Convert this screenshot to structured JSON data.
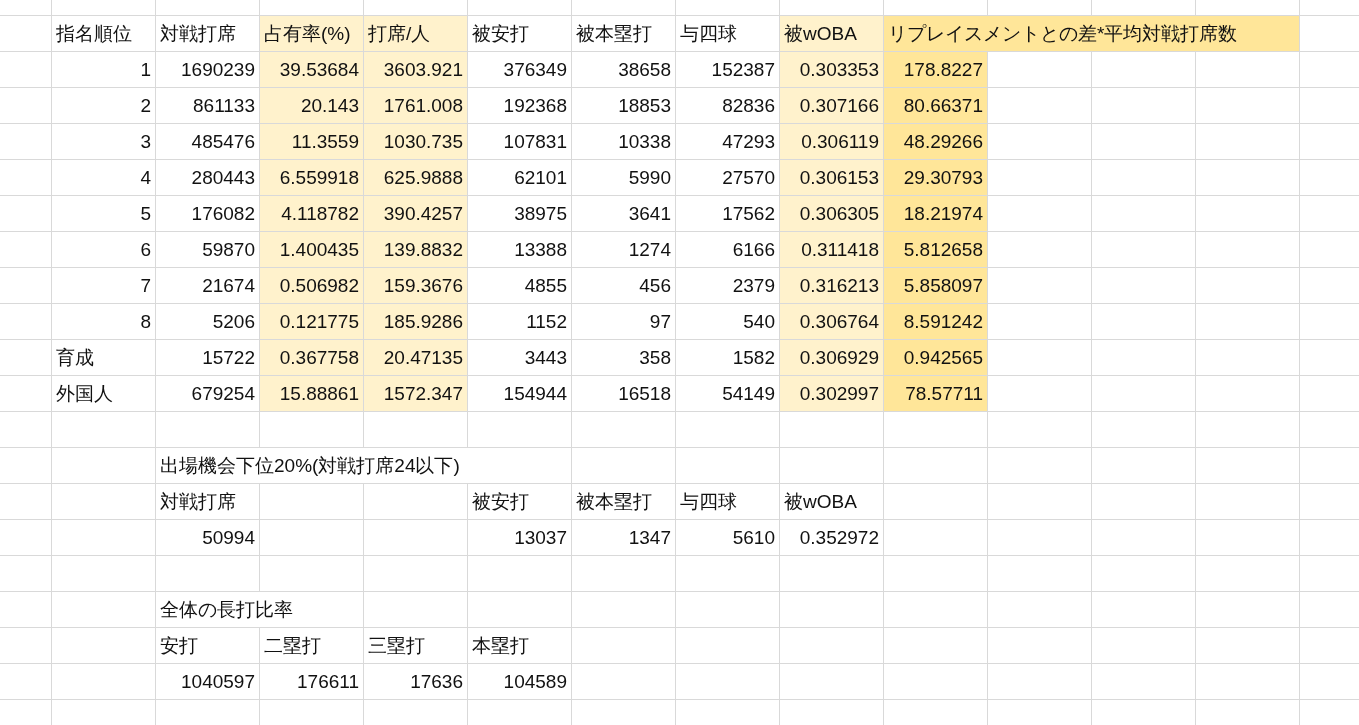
{
  "rows": [
    {
      "cells": [
        {
          "text": "指名順位",
          "kind": "text"
        },
        {
          "text": "対戦打席",
          "kind": "text"
        },
        {
          "text": "占有率(%)",
          "kind": "text",
          "color": "#fff2cc"
        },
        {
          "text": "打席/人",
          "kind": "text",
          "color": "#fff2cc"
        },
        {
          "text": "被安打",
          "kind": "text"
        },
        {
          "text": "被本塁打",
          "kind": "text"
        },
        {
          "text": "与四球",
          "kind": "text"
        },
        {
          "text": "被wOBA",
          "kind": "text",
          "color": "#fff2cc"
        },
        {
          "text": "リプレイスメントとの差*平均対戦打席数",
          "kind": "text",
          "color": "#ffe699"
        }
      ]
    },
    {
      "cells": [
        {
          "text": "1",
          "kind": "number"
        },
        {
          "text": "1690239",
          "kind": "number"
        },
        {
          "text": "39.53684",
          "kind": "number",
          "color": "#fff2cc"
        },
        {
          "text": "3603.921",
          "kind": "number",
          "color": "#fff2cc"
        },
        {
          "text": "376349",
          "kind": "number"
        },
        {
          "text": "38658",
          "kind": "number"
        },
        {
          "text": "152387",
          "kind": "number"
        },
        {
          "text": "0.303353",
          "kind": "number",
          "color": "#fff2cc"
        },
        {
          "text": "178.8227",
          "kind": "number",
          "color": "#ffe699"
        }
      ]
    },
    {
      "cells": [
        {
          "text": "2",
          "kind": "number"
        },
        {
          "text": "861133",
          "kind": "number"
        },
        {
          "text": "20.143",
          "kind": "number",
          "color": "#fff2cc"
        },
        {
          "text": "1761.008",
          "kind": "number",
          "color": "#fff2cc"
        },
        {
          "text": "192368",
          "kind": "number"
        },
        {
          "text": "18853",
          "kind": "number"
        },
        {
          "text": "82836",
          "kind": "number"
        },
        {
          "text": "0.307166",
          "kind": "number",
          "color": "#fff2cc"
        },
        {
          "text": "80.66371",
          "kind": "number",
          "color": "#ffe699"
        }
      ]
    },
    {
      "cells": [
        {
          "text": "3",
          "kind": "number"
        },
        {
          "text": "485476",
          "kind": "number"
        },
        {
          "text": "11.3559",
          "kind": "number",
          "color": "#fff2cc"
        },
        {
          "text": "1030.735",
          "kind": "number",
          "color": "#fff2cc"
        },
        {
          "text": "107831",
          "kind": "number"
        },
        {
          "text": "10338",
          "kind": "number"
        },
        {
          "text": "47293",
          "kind": "number"
        },
        {
          "text": "0.306119",
          "kind": "number",
          "color": "#fff2cc"
        },
        {
          "text": "48.29266",
          "kind": "number",
          "color": "#ffe699"
        }
      ]
    },
    {
      "cells": [
        {
          "text": "4",
          "kind": "number"
        },
        {
          "text": "280443",
          "kind": "number"
        },
        {
          "text": "6.559918",
          "kind": "number",
          "color": "#fff2cc"
        },
        {
          "text": "625.9888",
          "kind": "number",
          "color": "#fff2cc"
        },
        {
          "text": "62101",
          "kind": "number"
        },
        {
          "text": "5990",
          "kind": "number"
        },
        {
          "text": "27570",
          "kind": "number"
        },
        {
          "text": "0.306153",
          "kind": "number",
          "color": "#fff2cc"
        },
        {
          "text": "29.30793",
          "kind": "number",
          "color": "#ffe699"
        }
      ]
    },
    {
      "cells": [
        {
          "text": "5",
          "kind": "number"
        },
        {
          "text": "176082",
          "kind": "number"
        },
        {
          "text": "4.118782",
          "kind": "number",
          "color": "#fff2cc"
        },
        {
          "text": "390.4257",
          "kind": "number",
          "color": "#fff2cc"
        },
        {
          "text": "38975",
          "kind": "number"
        },
        {
          "text": "3641",
          "kind": "number"
        },
        {
          "text": "17562",
          "kind": "number"
        },
        {
          "text": "0.306305",
          "kind": "number",
          "color": "#fff2cc"
        },
        {
          "text": "18.21974",
          "kind": "number",
          "color": "#ffe699"
        }
      ]
    },
    {
      "cells": [
        {
          "text": "6",
          "kind": "number"
        },
        {
          "text": "59870",
          "kind": "number"
        },
        {
          "text": "1.400435",
          "kind": "number",
          "color": "#fff2cc"
        },
        {
          "text": "139.8832",
          "kind": "number",
          "color": "#fff2cc"
        },
        {
          "text": "13388",
          "kind": "number"
        },
        {
          "text": "1274",
          "kind": "number"
        },
        {
          "text": "6166",
          "kind": "number"
        },
        {
          "text": "0.311418",
          "kind": "number",
          "color": "#fff2cc"
        },
        {
          "text": "5.812658",
          "kind": "number",
          "color": "#ffe699"
        }
      ]
    },
    {
      "cells": [
        {
          "text": "7",
          "kind": "number"
        },
        {
          "text": "21674",
          "kind": "number"
        },
        {
          "text": "0.506982",
          "kind": "number",
          "color": "#fff2cc"
        },
        {
          "text": "159.3676",
          "kind": "number",
          "color": "#fff2cc"
        },
        {
          "text": "4855",
          "kind": "number"
        },
        {
          "text": "456",
          "kind": "number"
        },
        {
          "text": "2379",
          "kind": "number"
        },
        {
          "text": "0.316213",
          "kind": "number",
          "color": "#fff2cc"
        },
        {
          "text": "5.858097",
          "kind": "number",
          "color": "#ffe699"
        }
      ]
    },
    {
      "cells": [
        {
          "text": "8",
          "kind": "number"
        },
        {
          "text": "5206",
          "kind": "number"
        },
        {
          "text": "0.121775",
          "kind": "number",
          "color": "#fff2cc"
        },
        {
          "text": "185.9286",
          "kind": "number",
          "color": "#fff2cc"
        },
        {
          "text": "1152",
          "kind": "number"
        },
        {
          "text": "97",
          "kind": "number"
        },
        {
          "text": "540",
          "kind": "number"
        },
        {
          "text": "0.306764",
          "kind": "number",
          "color": "#fff2cc"
        },
        {
          "text": "8.591242",
          "kind": "number",
          "color": "#ffe699"
        }
      ]
    },
    {
      "cells": [
        {
          "text": "育成",
          "kind": "text"
        },
        {
          "text": "15722",
          "kind": "number"
        },
        {
          "text": "0.367758",
          "kind": "number",
          "color": "#fff2cc"
        },
        {
          "text": "20.47135",
          "kind": "number",
          "color": "#fff2cc"
        },
        {
          "text": "3443",
          "kind": "number"
        },
        {
          "text": "358",
          "kind": "number"
        },
        {
          "text": "1582",
          "kind": "number"
        },
        {
          "text": "0.306929",
          "kind": "number",
          "color": "#fff2cc"
        },
        {
          "text": "0.942565",
          "kind": "number",
          "color": "#ffe699"
        }
      ]
    },
    {
      "cells": [
        {
          "text": "外国人",
          "kind": "text"
        },
        {
          "text": "679254",
          "kind": "number"
        },
        {
          "text": "15.88861",
          "kind": "number",
          "color": "#fff2cc"
        },
        {
          "text": "1572.347",
          "kind": "number",
          "color": "#fff2cc"
        },
        {
          "text": "154944",
          "kind": "number"
        },
        {
          "text": "16518",
          "kind": "number"
        },
        {
          "text": "54149",
          "kind": "number"
        },
        {
          "text": "0.302997",
          "kind": "number",
          "color": "#fff2cc"
        },
        {
          "text": "78.57711",
          "kind": "number",
          "color": "#ffe699"
        }
      ]
    },
    {},
    {
      "cells": [
        null,
        {
          "text": "出場機会下位20%(対戦打席24以下)",
          "kind": "text"
        }
      ]
    },
    {
      "cells": [
        null,
        {
          "text": "対戦打席",
          "kind": "text"
        },
        null,
        null,
        {
          "text": "被安打",
          "kind": "text"
        },
        {
          "text": "被本塁打",
          "kind": "text"
        },
        {
          "text": "与四球",
          "kind": "text"
        },
        {
          "text": "被wOBA",
          "kind": "text"
        }
      ]
    },
    {
      "cells": [
        null,
        {
          "text": "50994",
          "kind": "number"
        },
        null,
        null,
        {
          "text": "13037",
          "kind": "number"
        },
        {
          "text": "1347",
          "kind": "number"
        },
        {
          "text": "5610",
          "kind": "number"
        },
        {
          "text": "0.352972",
          "kind": "number"
        }
      ]
    },
    {},
    {
      "cells": [
        null,
        {
          "text": "全体の長打比率",
          "kind": "text"
        }
      ]
    },
    {
      "cells": [
        null,
        {
          "text": "安打",
          "kind": "text"
        },
        {
          "text": "二塁打",
          "kind": "text"
        },
        {
          "text": "三塁打",
          "kind": "text"
        },
        {
          "text": "本塁打",
          "kind": "text"
        }
      ]
    },
    {
      "cells": [
        null,
        {
          "text": "1040597",
          "kind": "number"
        },
        {
          "text": "176611",
          "kind": "number"
        },
        {
          "text": "17636",
          "kind": "number"
        },
        {
          "text": "104589",
          "kind": "number"
        }
      ]
    }
  ]
}
